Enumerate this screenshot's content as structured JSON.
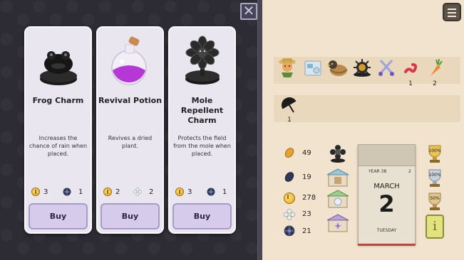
{
  "shop": {
    "close_label": "✕",
    "cards": [
      {
        "name": "Frog Charm",
        "desc": "Increases the chance of rain when placed.",
        "cost_coins": "3",
        "cost_other": "1",
        "other_icon": "dark-seed-icon",
        "buy_label": "Buy"
      },
      {
        "name": "Revival Potion",
        "desc": "Revives a dried plant.",
        "cost_coins": "2",
        "cost_other": "2",
        "other_icon": "light-flower-icon",
        "buy_label": "Buy"
      },
      {
        "name": "Mole Repellent Charm",
        "desc": "Protects the field from the mole when placed.",
        "cost_coins": "3",
        "cost_other": "1",
        "other_icon": "dark-seed-icon",
        "buy_label": "Buy"
      }
    ]
  },
  "inventory": {
    "items_row1": [
      {
        "icon": "scarecrow-icon",
        "count": ""
      },
      {
        "icon": "sprinkler-box-icon",
        "count": ""
      },
      {
        "icon": "nest-bird-icon",
        "count": ""
      },
      {
        "icon": "mine-bomb-icon",
        "count": ""
      },
      {
        "icon": "scissors-icon",
        "count": ""
      },
      {
        "icon": "worm-icon",
        "count": "1"
      },
      {
        "icon": "carrot-icon",
        "count": "2"
      }
    ],
    "items_row2": [
      {
        "icon": "umbrella-icon",
        "count": "1"
      }
    ]
  },
  "resources": [
    {
      "icon": "seed-icon",
      "value": "49"
    },
    {
      "icon": "dark-seed-leaf-icon",
      "value": "19"
    },
    {
      "icon": "coin-icon",
      "value": "278"
    },
    {
      "icon": "light-flower-icon",
      "value": "23"
    },
    {
      "icon": "dark-flower-icon",
      "value": "21"
    }
  ],
  "calendar": {
    "year": "YEAR 38",
    "page": "2",
    "month": "MARCH",
    "day": "2",
    "weekday": "TUESDAY"
  },
  "trophies": [
    "100%",
    "100%",
    "50%"
  ],
  "info_label": "i",
  "colors": {
    "card_bg": "#e9e6f0",
    "buy_button": "#d6cbeb",
    "inventory_bg": "#f1e3cd",
    "calendar_accent": "#c0443a"
  }
}
